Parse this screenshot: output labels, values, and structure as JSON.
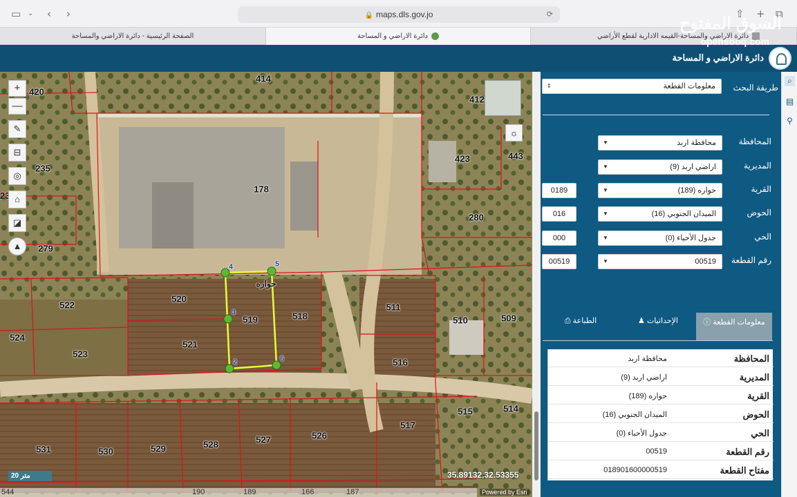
{
  "browser": {
    "url": "maps.dls.gov.jo",
    "tabs": [
      {
        "label": "الصفحة الرئيسية - دائرة الاراضي والمساحة"
      },
      {
        "label": "دائرة الاراضي و المساحة"
      },
      {
        "label": "دائرة الاراضي والمساحة-القيمه الادارية لقطع الأراضي"
      }
    ]
  },
  "watermark": {
    "brand": "السوق المفتوح",
    "sub": "opensooq.com"
  },
  "app": {
    "title": "دائرة الاراضي و المساحة"
  },
  "map": {
    "controls": {
      "zoom_in": "+",
      "zoom_out": "—"
    },
    "scale": "20 متر",
    "coords": "35.89132,32.53355",
    "attribution": "Powered by Esri",
    "village_label": "حواره",
    "plots": [
      "420",
      "414",
      "412",
      "235",
      "178",
      "423",
      "443",
      "280",
      "279",
      "520",
      "519",
      "518",
      "522",
      "521",
      "524",
      "523",
      "511",
      "510",
      "509",
      "516",
      "515",
      "514",
      "517",
      "531",
      "530",
      "529",
      "528",
      "527",
      "526"
    ],
    "vertices": [
      "4",
      "5",
      "3",
      "2",
      "6"
    ],
    "bottom_numbers": [
      "544",
      "190",
      "189",
      "166",
      "187"
    ]
  },
  "panel": {
    "search_method_label": "طريقة البحث",
    "search_method_value": "معلومات القطعة",
    "fields": [
      {
        "label": "المحافظة",
        "value": "محافظة اربد",
        "code": ""
      },
      {
        "label": "المديرية",
        "value": "اراضي اربد (9)",
        "code": ""
      },
      {
        "label": "القرية",
        "value": "حواره (189)",
        "code": "0189"
      },
      {
        "label": "الحوض",
        "value": "الميدان الجنوبي (16)",
        "code": "016"
      },
      {
        "label": "الحي",
        "value": "جدول الأحياء (0)",
        "code": "000"
      },
      {
        "label": "رقم القطعة",
        "value": "00519",
        "code": "00519"
      }
    ],
    "tabs": {
      "info": "معلومات القطعة",
      "coords": "الإحداثيات",
      "print": "الطباعة"
    },
    "info_rows": [
      {
        "key": "المحافظة",
        "value": "محافظة اربد"
      },
      {
        "key": "المديرية",
        "value": "اراضي اربد (9)"
      },
      {
        "key": "القرية",
        "value": "حواره (189)"
      },
      {
        "key": "الحوض",
        "value": "الميدان الجنوبي (16)"
      },
      {
        "key": "الحي",
        "value": "جدول الأحياء (0)"
      },
      {
        "key": "رقم القطعة",
        "value": "00519"
      },
      {
        "key": "مفتاح القطعة",
        "value": "018901600000519"
      }
    ]
  }
}
